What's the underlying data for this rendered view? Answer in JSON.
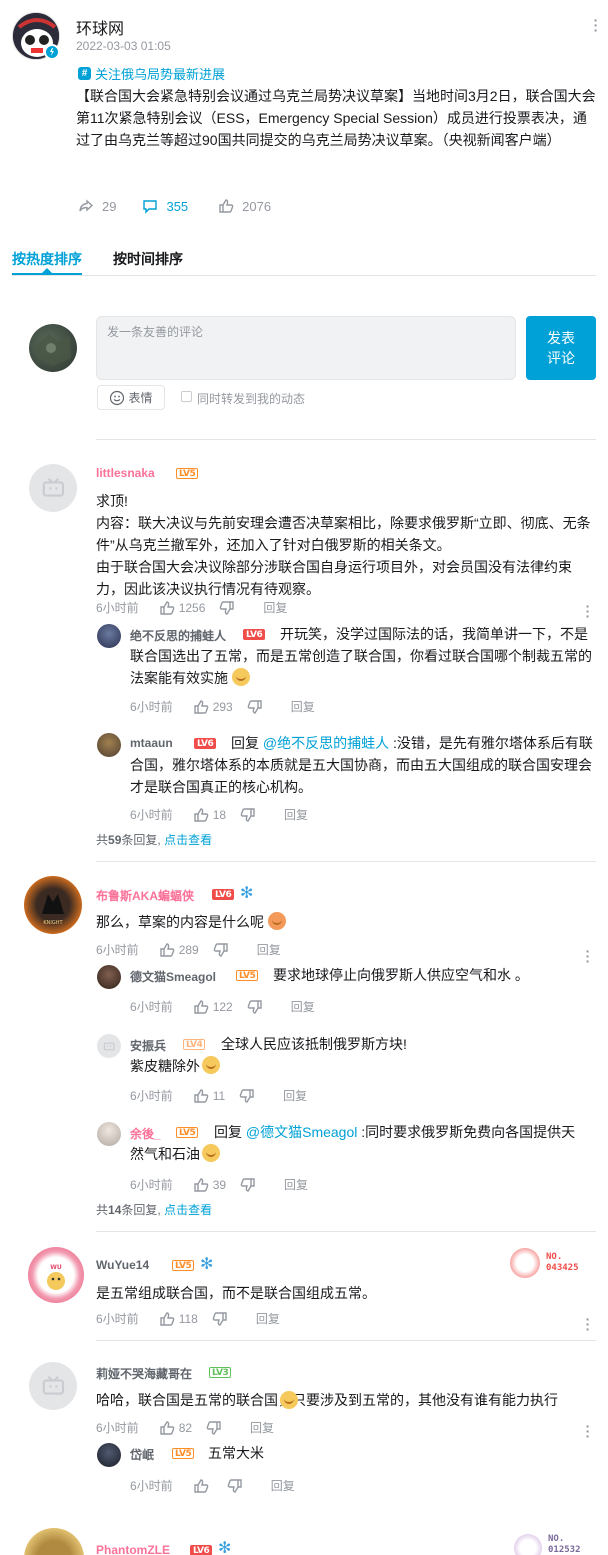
{
  "post": {
    "author": "环球网",
    "time": "2022-03-03 01:05",
    "topic": "关注俄乌局势最新进展",
    "content": "【联合国大会紧急特别会议通过乌克兰局势决议草案】当地时间3月2日，联合国大会第11次紧急特别会议（ESS，Emergency Special Session）成员进行投票表决，通过了由乌克兰等超过90国共同提交的乌克兰局势决议草案。（央视新闻客户端）",
    "share_count": "29",
    "comment_count": "355",
    "like_count": "2076"
  },
  "tabs": {
    "hot": "按热度排序",
    "time": "按时间排序"
  },
  "composer": {
    "placeholder": "发一条友善的评论",
    "submit": "发表\n评论",
    "emoji": "表情",
    "repost": "同时转发到我的动态"
  },
  "colors": {
    "accent": "#00a1d6",
    "pink": "#fb7299"
  },
  "reply_label": "回复",
  "comments": [
    {
      "user": "littlesnaka",
      "level": "LV5",
      "text": "求顶!\n内容：联大决议与先前安理会遭否决草案相比，除要求俄罗斯“立即、彻底、无条件”从乌克兰撤军外，还加入了针对白俄罗斯的相关条文。\n由于联合国大会决议除部分涉联合国自身运行项目外，对会员国没有法律约束力，因此该决议执行情况有待观察。",
      "time": "6小时前",
      "likes": "1256",
      "replies": [
        {
          "user": "绝不反思的捕蛙人",
          "level": "LV6",
          "text": "开玩笑，没学过国际法的话，我简单讲一下，不是联合国选出了五常，而是五常创造了联合国，你看过联合国哪个制裁五常的法案能有效实施",
          "time": "6小时前",
          "likes": "293"
        },
        {
          "user": "mtaaun",
          "level": "LV6",
          "reply_to": "@绝不反思的捕蛙人",
          "text": ":没错，是先有雅尔塔体系后有联合国，雅尔塔体系的本质就是五大国协商，而由五大国组成的联合国安理会才是联合国真正的核心机构。",
          "time": "6小时前",
          "likes": "18"
        }
      ],
      "more": {
        "prefix": "共",
        "count": "59",
        "suffix": "条回复,",
        "link": "点击查看"
      }
    },
    {
      "user": "布鲁斯AKA蝙蝠侠",
      "level": "LV6",
      "text": "那么，草案的内容是什么呢",
      "time": "6小时前",
      "likes": "289",
      "replies": [
        {
          "user": "德文猫Smeagol",
          "level": "LV5",
          "text": "要求地球停止向俄罗斯人供应空气和水 。",
          "time": "6小时前",
          "likes": "122"
        },
        {
          "user": "安振兵",
          "level": "LV4",
          "text": "全球人民应该抵制俄罗斯方块!\n紫皮糖除外",
          "time": "6小时前",
          "likes": "11"
        },
        {
          "user": "余後_",
          "level": "LV5",
          "reply_to": "@德文猫Smeagol",
          "text": ":同时要求俄罗斯免费向各国提供天然气和石油",
          "time": "6小时前",
          "likes": "39"
        }
      ],
      "more": {
        "prefix": "共",
        "count": "14",
        "suffix": "条回复,",
        "link": "点击查看"
      }
    },
    {
      "user": "WuYue14",
      "level": "LV5",
      "text": "是五常组成联合国，而不是联合国组成五常。",
      "time": "6小时前",
      "likes": "118",
      "badge_no": "NO.\n043425"
    },
    {
      "user": "莉娅不哭海藏哥在",
      "level": "LV3",
      "text": "哈哈，联合国是五常的联合国，只要涉及到五常的，其他没有谁有能力执行",
      "time": "6小时前",
      "likes": "82",
      "replies": [
        {
          "user": "岱岷",
          "level": "LV5",
          "text": "五常大米",
          "time": "6小时前",
          "likes": ""
        }
      ]
    },
    {
      "user": "PhantomZLE",
      "level": "LV6",
      "badge_no": "NO.\n012532"
    }
  ]
}
